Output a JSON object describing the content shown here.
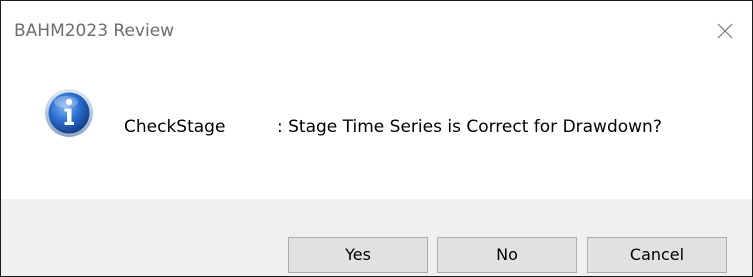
{
  "window": {
    "title": "BAHM2023 Review",
    "close_icon": "close-icon"
  },
  "message": {
    "icon": "information-icon",
    "caption": "CheckStage",
    "text": ": Stage Time Series is Correct for Drawdown?"
  },
  "buttons": {
    "yes_label": "Yes",
    "no_label": "No",
    "cancel_label": "Cancel"
  },
  "colors": {
    "footer_background": "#f0f0f0",
    "button_background": "#e1e1e1",
    "default_button_border": "#0078d7",
    "info_icon_blue": "#1f5fbf"
  }
}
